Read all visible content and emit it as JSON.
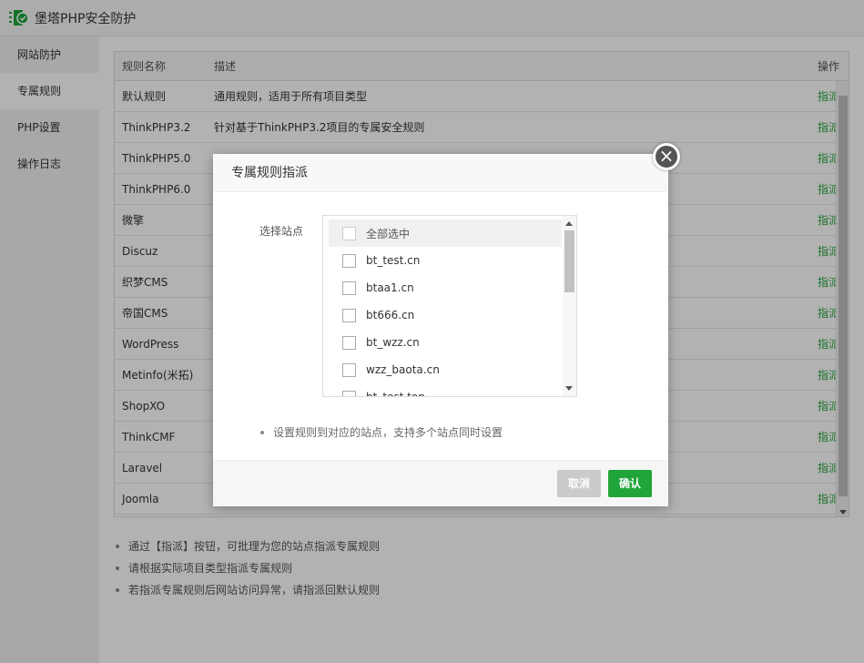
{
  "app": {
    "title": "堡塔PHP安全防护"
  },
  "sidebar": {
    "items": [
      {
        "label": "网站防护"
      },
      {
        "label": "专属规则"
      },
      {
        "label": "PHP设置"
      },
      {
        "label": "操作日志"
      }
    ]
  },
  "table": {
    "columns": {
      "name": "规则名称",
      "desc": "描述",
      "op": "操作"
    },
    "rows": [
      {
        "name": "默认规则",
        "desc": "通用规则，适用于所有项目类型",
        "op": "指派"
      },
      {
        "name": "ThinkPHP3.2",
        "desc": "针对基于ThinkPHP3.2项目的专属安全规则",
        "op": "指派"
      },
      {
        "name": "ThinkPHP5.0",
        "desc": "",
        "op": "指派"
      },
      {
        "name": "ThinkPHP6.0",
        "desc": "",
        "op": "指派"
      },
      {
        "name": "微擎",
        "desc": "",
        "op": "指派"
      },
      {
        "name": "Discuz",
        "desc": "",
        "op": "指派"
      },
      {
        "name": "织梦CMS",
        "desc": "",
        "op": "指派"
      },
      {
        "name": "帝国CMS",
        "desc": "",
        "op": "指派"
      },
      {
        "name": "WordPress",
        "desc": "",
        "op": "指派"
      },
      {
        "name": "Metinfo(米拓)",
        "desc": "",
        "op": "指派"
      },
      {
        "name": "ShopXO",
        "desc": "",
        "op": "指派"
      },
      {
        "name": "ThinkCMF",
        "desc": "",
        "op": "指派"
      },
      {
        "name": "Laravel",
        "desc": "",
        "op": "指派"
      },
      {
        "name": "Joomla",
        "desc": "",
        "op": "指派"
      }
    ]
  },
  "notes": [
    "通过【指派】按钮，可批理为您的站点指派专属规则",
    "请根据实际项目类型指派专属规则",
    "若指派专属规则后网站访问异常，请指派回默认规则"
  ],
  "modal": {
    "title": "专属规则指派",
    "close_icon": "×",
    "field_label": "选择站点",
    "select_all": "全部选中",
    "sites": [
      "bt_test.cn",
      "btaa1.cn",
      "bt666.cn",
      "bt_wzz.cn",
      "wzz_baota.cn",
      "bt_test.top"
    ],
    "tip": "设置规则到对应的站点，支持多个站点同时设置",
    "cancel_label": "取消",
    "ok_label": "确认"
  },
  "colors": {
    "accent": "#20a53a",
    "cancel": "#cbcbcb"
  }
}
